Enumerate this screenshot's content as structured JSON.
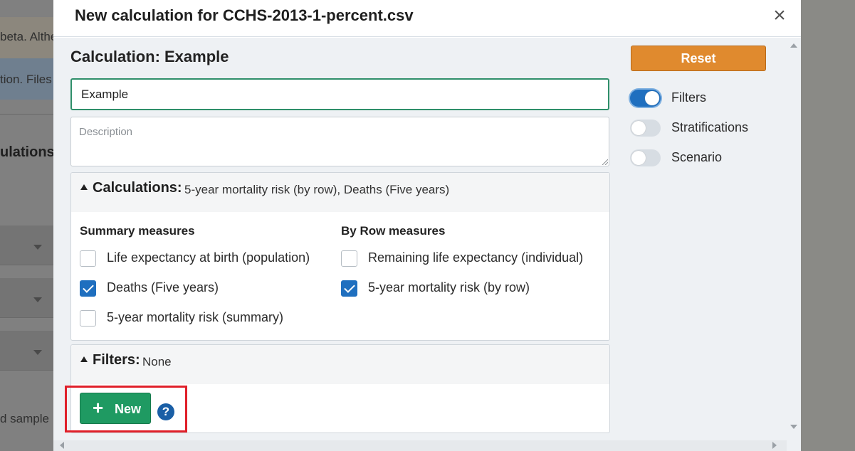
{
  "background": {
    "text_1": "beta. Althe",
    "text_2": "tion. Files",
    "heading": "ulations",
    "text_3": "d sample"
  },
  "modal": {
    "title": "New calculation for CCHS-2013-1-percent.csv",
    "close_glyph": "×"
  },
  "calculation": {
    "title": "Calculation: Example",
    "name_value": "Example",
    "description_placeholder": "Description"
  },
  "calculations_panel": {
    "label": "Calculations:",
    "value": "5-year mortality risk (by row), Deaths (Five years)",
    "summary_title": "Summary measures",
    "row_title": "By Row measures",
    "summary_items": [
      {
        "label": "Life expectancy at birth (population)",
        "checked": false
      },
      {
        "label": "Deaths (Five years)",
        "checked": true
      },
      {
        "label": "5-year mortality risk (summary)",
        "checked": false
      }
    ],
    "row_items": [
      {
        "label": "Remaining life expectancy (individual)",
        "checked": false
      },
      {
        "label": "5-year mortality risk (by row)",
        "checked": true
      }
    ]
  },
  "filters_panel": {
    "label": "Filters:",
    "value": "None",
    "new_button_icon": "+",
    "new_button_label": "New",
    "help_icon_glyph": "?"
  },
  "sidebar": {
    "reset_label": "Reset",
    "toggles": [
      {
        "label": "Filters",
        "on": true
      },
      {
        "label": "Stratifications",
        "on": false
      },
      {
        "label": "Scenario",
        "on": false
      }
    ]
  },
  "colors": {
    "primary_blue": "#1f6fbf",
    "new_button_green": "#1f9a62",
    "reset_orange": "#e08a2e",
    "input_focus_green": "#2f8f6a",
    "highlight_red": "#e0202a",
    "help_icon_blue": "#1a5fa6"
  }
}
